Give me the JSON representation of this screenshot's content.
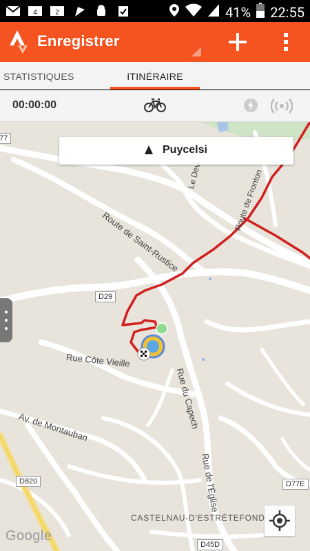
{
  "status_bar": {
    "battery": "41%",
    "time": "22:55",
    "icons": [
      "mail-icon",
      "voicemail-icon-4",
      "voicemail-icon-2",
      "flag-icon",
      "android-icon",
      "check-clipboard-icon",
      "location-pin-icon",
      "wifi-icon",
      "signal-icon",
      "battery-icon"
    ]
  },
  "app_bar": {
    "title": "Enregistrer",
    "logo": "strava-logo",
    "add_icon": "plus-icon",
    "menu_icon": "more-vert-icon",
    "color": "#f5531f"
  },
  "tabs": [
    {
      "label": "STATISTIQUES",
      "active": false
    },
    {
      "label": "ITINÉRAIRE",
      "active": true
    }
  ],
  "stats": {
    "timer": "00:00:00",
    "activity_icon": "bike-icon",
    "gps_icon": "gps-signal-icon",
    "sensor_icon": "broadcast-icon"
  },
  "map": {
    "destination": "Puycelsi",
    "labels": {
      "route_saint_rustice": "Route de Saint-Rustice",
      "route_fronton": "Route de Fronton",
      "le_devez": "Le Devez",
      "rue_cote_vieille": "Rue Côte Vieille",
      "rue_capech": "Rue du Capech",
      "av_montauban": "Av. de Montauban",
      "rue_eglise": "Rue de l'Église",
      "town": "CASTELNAU-D'ESTRÉTEFONDS"
    },
    "road_badges": {
      "d77": "77",
      "d29": "D29",
      "d820": "D820",
      "d77e": "D77E",
      "d45d": "D45D"
    },
    "attribution": "Google",
    "route_color": "#d0201e"
  }
}
